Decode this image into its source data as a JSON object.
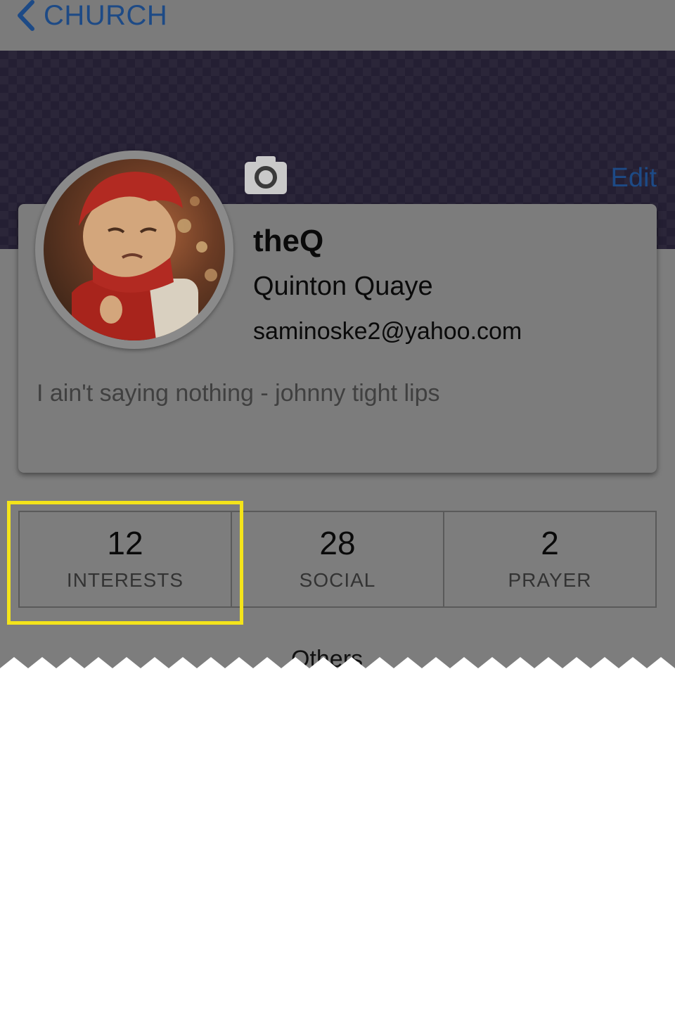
{
  "nav": {
    "back_label": "CHURCH",
    "back_icon": "chevron-left-icon",
    "accent": "#1d4a86"
  },
  "header": {
    "edit_label": "Edit",
    "camera_icon": "camera-icon"
  },
  "profile": {
    "username": "theQ",
    "full_name": "Quinton Quaye",
    "email": "saminoske2@yahoo.com",
    "bio": "I ain't saying nothing - johnny tight lips"
  },
  "stats": [
    {
      "value": "12",
      "label": "INTERESTS"
    },
    {
      "value": "28",
      "label": "SOCIAL"
    },
    {
      "value": "2",
      "label": "PRAYER"
    }
  ],
  "partial_section": {
    "label": "Others"
  },
  "colors": {
    "highlight": "#f4e41a",
    "banner": "#241f33"
  }
}
